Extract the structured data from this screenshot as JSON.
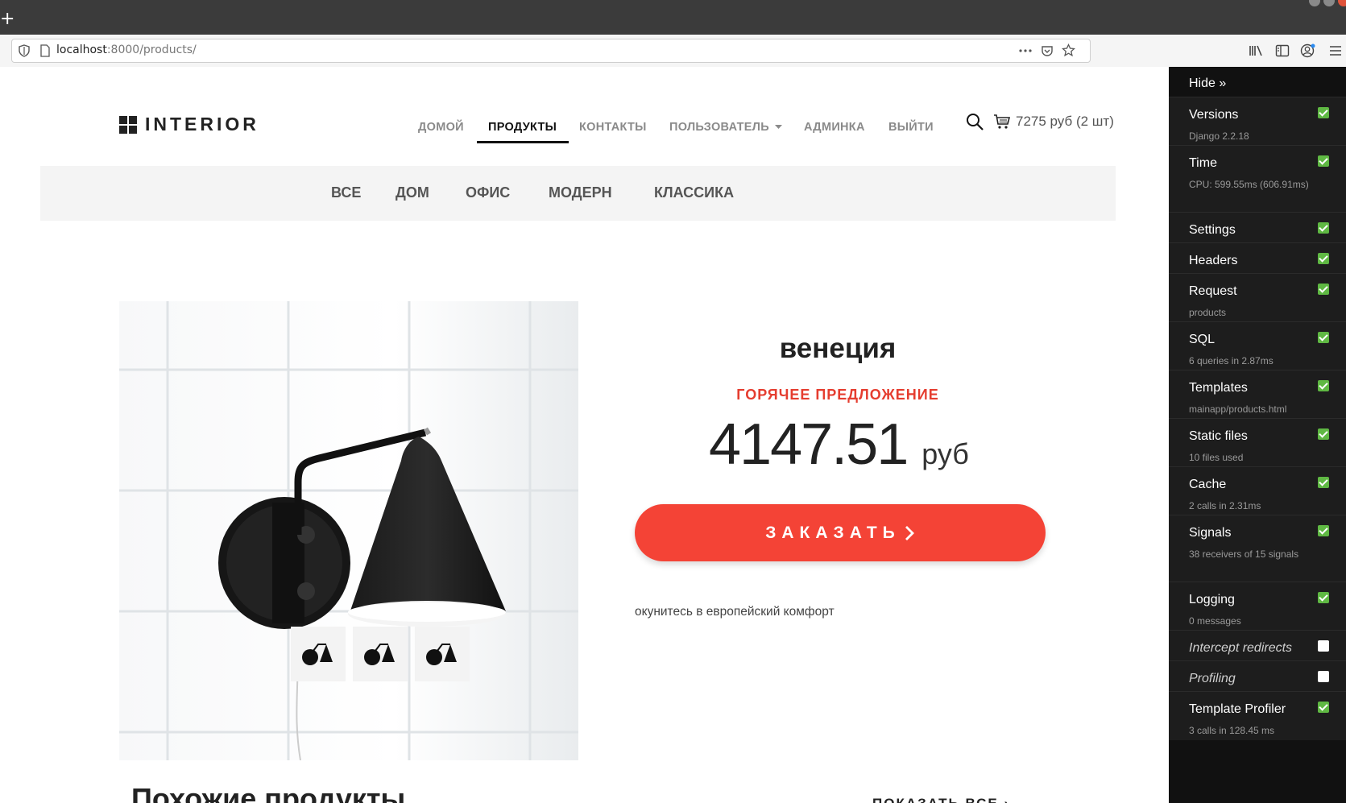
{
  "browser": {
    "new_tab": "+",
    "url_host": "localhost",
    "url_rest": ":8000/products/"
  },
  "site": {
    "logo": "INTERIOR",
    "menu": [
      "ДОМОЙ",
      "ПРОДУКТЫ",
      "КОНТАКТЫ",
      "ПОЛЬЗОВАТЕЛЬ",
      "АДМИНКА",
      "ВЫЙТИ"
    ],
    "cart": "7275 руб (2 шт)",
    "categories": [
      "ВСЕ",
      "ДОМ",
      "ОФИС",
      "МОДЕРН",
      "КЛАССИКА"
    ]
  },
  "product": {
    "name": "венеция",
    "hot": "ГОРЯЧЕЕ ПРЕДЛОЖЕНИЕ",
    "price": "4147.51",
    "currency": "руб",
    "order": "ЗАКАЗАТЬ",
    "description": "окунитесь в европейский комфорт"
  },
  "similar": {
    "title": "Похожие продукты",
    "show_all": "ПОКАЗАТЬ ВСЕ"
  },
  "toolbar": {
    "hide": "Hide »",
    "panels": [
      {
        "title": "Versions",
        "sub": "Django 2.2.18",
        "on": true
      },
      {
        "title": "Time",
        "sub": "CPU: 599.55ms (606.91ms)",
        "on": true
      },
      {
        "title": "Settings",
        "sub": "",
        "on": true
      },
      {
        "title": "Headers",
        "sub": "",
        "on": true
      },
      {
        "title": "Request",
        "sub": "products",
        "on": true
      },
      {
        "title": "SQL",
        "sub": "6 queries in 2.87ms",
        "on": true
      },
      {
        "title": "Templates",
        "sub": "mainapp/products.html",
        "on": true
      },
      {
        "title": "Static files",
        "sub": "10 files used",
        "on": true
      },
      {
        "title": "Cache",
        "sub": "2 calls in 2.31ms",
        "on": true
      },
      {
        "title": "Signals",
        "sub": "38 receivers of 15 signals",
        "on": true
      },
      {
        "title": "Logging",
        "sub": "0 messages",
        "on": true
      },
      {
        "title": "Intercept redirects",
        "sub": "",
        "on": false
      },
      {
        "title": "Profiling",
        "sub": "",
        "on": false
      },
      {
        "title": "Template Profiler",
        "sub": "3 calls in 128.45 ms",
        "on": true
      }
    ]
  }
}
